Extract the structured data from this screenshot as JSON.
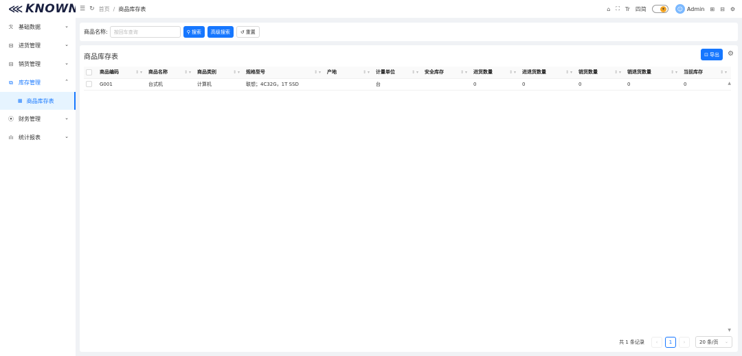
{
  "brand": {
    "logo_text": "KNOWN",
    "logo_mark": "✪"
  },
  "breadcrumb": {
    "home": "首页",
    "separator": "/",
    "current": "商品库存表"
  },
  "header": {
    "user": "Admin",
    "lang_label": "Tr",
    "simplify_label": "四简"
  },
  "sidebar": {
    "items": [
      {
        "label": "基础数据",
        "icon": "user-icon",
        "glyph": "♂"
      },
      {
        "label": "进货管理",
        "icon": "box-icon",
        "glyph": "▣"
      },
      {
        "label": "销货管理",
        "icon": "box-icon",
        "glyph": "▣"
      },
      {
        "label": "库存管理",
        "icon": "inventory-icon",
        "glyph": "⧉"
      },
      {
        "label": "财务管理",
        "icon": "finance-icon",
        "glyph": "⦿"
      },
      {
        "label": "统计报表",
        "icon": "chart-icon",
        "glyph": "▇"
      }
    ],
    "sub_item": "商品库存表"
  },
  "search": {
    "label": "商品名称:",
    "placeholder": "按回车查询",
    "search_btn": "搜索",
    "advanced_btn": "高级搜索",
    "reset_btn": "重置"
  },
  "table": {
    "title": "商品库存表",
    "export_btn": "导出",
    "columns": [
      "商品编码",
      "商品名称",
      "商品类别",
      "规格型号",
      "产地",
      "计量单位",
      "安全库存",
      "进货数量",
      "进退货数量",
      "销货数量",
      "销退货数量",
      "当前库存"
    ],
    "rows": [
      [
        "G001",
        "台式机",
        "计算机",
        "联想；4C32G，1T SSD",
        "",
        "台",
        "",
        "0",
        "0",
        "0",
        "0",
        "0"
      ]
    ]
  },
  "pagination": {
    "total": "共 1 条记录",
    "current": "1",
    "page_size": "20 条/页"
  },
  "colors": {
    "primary": "#1677ff",
    "menu_active_bg": "#e6f4ff"
  }
}
